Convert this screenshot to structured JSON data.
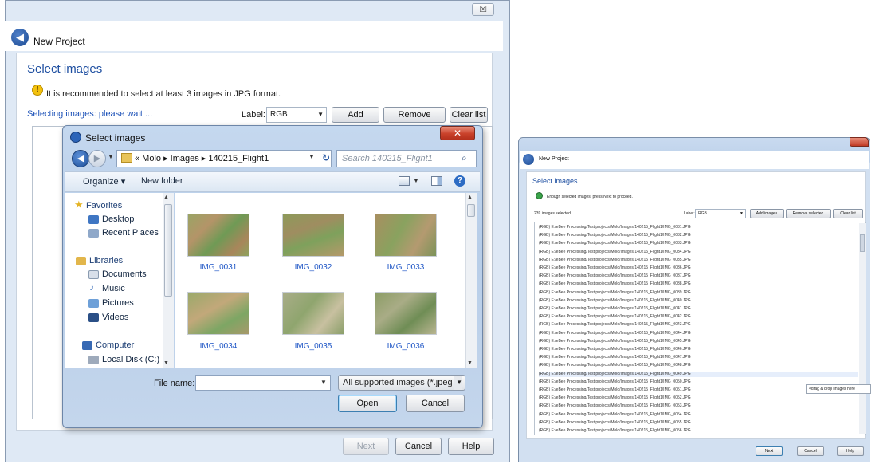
{
  "left_window": {
    "close_glyph": "☒",
    "title": "New Project",
    "heading": "Select images",
    "warning": "It is recommended to select at least 3 images in JPG format.",
    "status": "Selecting images: please wait ...",
    "label_caption": "Label:",
    "label_value": "RGB",
    "add_images": "Add images",
    "remove_selected": "Remove selected",
    "clear_list": "Clear list",
    "next": "Next",
    "cancel": "Cancel",
    "help": "Help"
  },
  "open_dialog": {
    "title": "Select images",
    "close_glyph": "✕",
    "address": "« Molo ▸ Images ▸ 140215_Flight1",
    "search_placeholder": "Search 140215_Flight1",
    "organize": "Organize ▾",
    "new_folder": "New folder",
    "nav": {
      "favorites": "Favorites",
      "desktop": "Desktop",
      "recent": "Recent Places",
      "libraries": "Libraries",
      "documents": "Documents",
      "music": "Music",
      "pictures": "Pictures",
      "videos": "Videos",
      "computer": "Computer",
      "local_disk": "Local Disk (C:)"
    },
    "files": [
      "IMG_0031",
      "IMG_0032",
      "IMG_0033",
      "IMG_0034",
      "IMG_0035",
      "IMG_0036"
    ],
    "file_name_label": "File name:",
    "file_name_value": "",
    "filter": "All supported images (*.jpeg *.j",
    "open": "Open",
    "cancel": "Cancel"
  },
  "right_window": {
    "title": "New Project",
    "heading": "Select images",
    "ok_message": "Enough selected images: press Next to proceed.",
    "count": "239 images selected",
    "label_caption": "Label:",
    "label_value": "RGB",
    "add_images": "Add images",
    "remove_selected": "Remove selected",
    "clear_list": "Clear list",
    "rows": [
      "(RGB) E:/eBee Processing/Test projects/Molo/Images/140215_Flight1/IMG_0031.JPG",
      "(RGB) E:/eBee Processing/Test projects/Molo/Images/140215_Flight1/IMG_0032.JPG",
      "(RGB) E:/eBee Processing/Test projects/Molo/Images/140215_Flight1/IMG_0033.JPG",
      "(RGB) E:/eBee Processing/Test projects/Molo/Images/140215_Flight1/IMG_0034.JPG",
      "(RGB) E:/eBee Processing/Test projects/Molo/Images/140215_Flight1/IMG_0035.JPG",
      "(RGB) E:/eBee Processing/Test projects/Molo/Images/140215_Flight1/IMG_0036.JPG",
      "(RGB) E:/eBee Processing/Test projects/Molo/Images/140215_Flight1/IMG_0037.JPG",
      "(RGB) E:/eBee Processing/Test projects/Molo/Images/140215_Flight1/IMG_0038.JPG",
      "(RGB) E:/eBee Processing/Test projects/Molo/Images/140215_Flight1/IMG_0039.JPG",
      "(RGB) E:/eBee Processing/Test projects/Molo/Images/140215_Flight1/IMG_0040.JPG",
      "(RGB) E:/eBee Processing/Test projects/Molo/Images/140215_Flight1/IMG_0041.JPG",
      "(RGB) E:/eBee Processing/Test projects/Molo/Images/140215_Flight1/IMG_0042.JPG",
      "(RGB) E:/eBee Processing/Test projects/Molo/Images/140215_Flight1/IMG_0043.JPG",
      "(RGB) E:/eBee Processing/Test projects/Molo/Images/140215_Flight1/IMG_0044.JPG",
      "(RGB) E:/eBee Processing/Test projects/Molo/Images/140215_Flight1/IMG_0045.JPG",
      "(RGB) E:/eBee Processing/Test projects/Molo/Images/140215_Flight1/IMG_0046.JPG",
      "(RGB) E:/eBee Processing/Test projects/Molo/Images/140215_Flight1/IMG_0047.JPG",
      "(RGB) E:/eBee Processing/Test projects/Molo/Images/140215_Flight1/IMG_0048.JPG",
      "(RGB) E:/eBee Processing/Test projects/Molo/Images/140215_Flight1/IMG_0049.JPG",
      "(RGB) E:/eBee Processing/Test projects/Molo/Images/140215_Flight1/IMG_0050.JPG",
      "(RGB) E:/eBee Processing/Test projects/Molo/Images/140215_Flight1/IMG_0051.JPG",
      "(RGB) E:/eBee Processing/Test projects/Molo/Images/140215_Flight1/IMG_0052.JPG",
      "(RGB) E:/eBee Processing/Test projects/Molo/Images/140215_Flight1/IMG_0053.JPG",
      "(RGB) E:/eBee Processing/Test projects/Molo/Images/140215_Flight1/IMG_0054.JPG",
      "(RGB) E:/eBee Processing/Test projects/Molo/Images/140215_Flight1/IMG_0055.JPG",
      "(RGB) E:/eBee Processing/Test projects/Molo/Images/140215_Flight1/IMG_0056.JPG"
    ],
    "drop_hint": "<drag & drop images here",
    "next": "Next",
    "cancel": "Cancel",
    "help": "Help"
  }
}
